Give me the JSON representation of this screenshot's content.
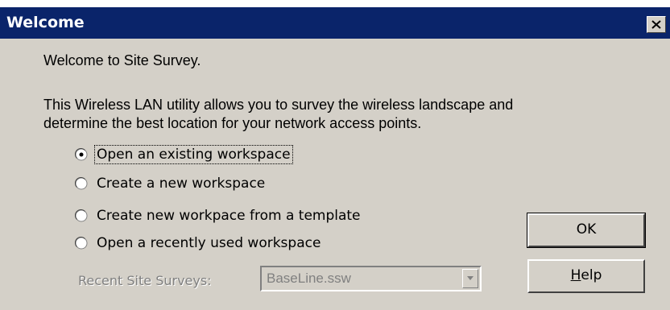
{
  "window": {
    "title": "Welcome"
  },
  "content": {
    "greeting": "Welcome to Site Survey.",
    "description_line1": "This Wireless LAN utility allows you to survey the wireless landscape and",
    "description_line2": "determine the best location for your network access points."
  },
  "options": [
    {
      "label": "Open an existing workspace",
      "selected": true
    },
    {
      "label": "Create a new workspace",
      "selected": false
    },
    {
      "label": "Create new workpace from a template",
      "selected": false
    },
    {
      "label": "Open a recently used workspace",
      "selected": false
    }
  ],
  "recent": {
    "label": "Recent Site Surveys:",
    "selected_value": "BaseLine.ssw"
  },
  "buttons": {
    "ok_label": "OK",
    "help_label": "Help"
  },
  "colors": {
    "titlebar": "#0a246a",
    "dialog_background": "#d4d0c8",
    "disabled_text": "#808080"
  }
}
